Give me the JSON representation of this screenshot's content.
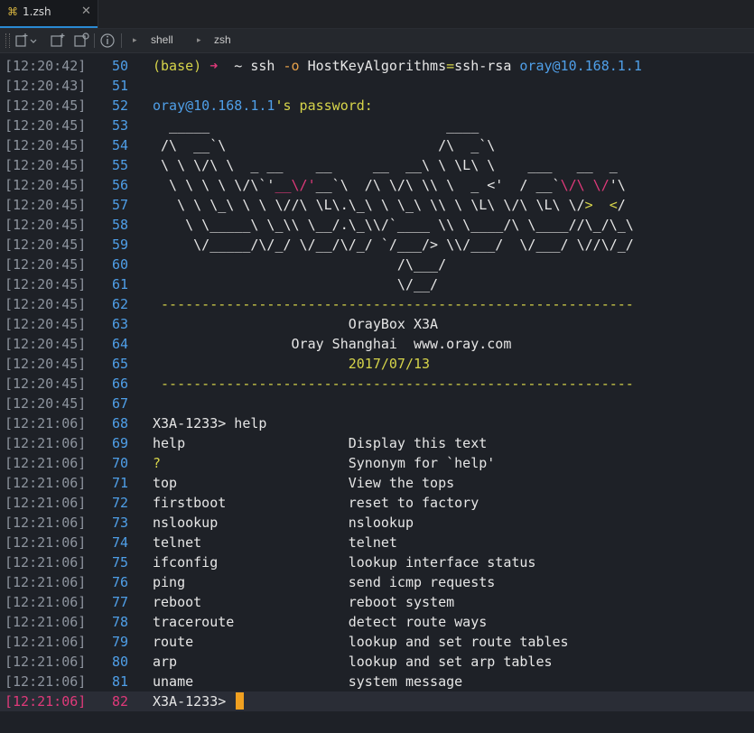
{
  "tab": {
    "cmd_glyph": "⌘",
    "title": "1.zsh",
    "close_glyph": "✕"
  },
  "toolbar": {
    "new_tab_icon": "new-tab-icon",
    "new_window_icon": "new-window-icon",
    "restart_icon": "restart-icon",
    "info_icon": "info-icon",
    "crumbs": [
      "shell",
      "zsh"
    ]
  },
  "colors": {
    "accent": "#2a8ad4",
    "prompt_arrow": "#e0397a",
    "cursor": "#f0a020",
    "line_numbers": "#4f9fe8",
    "timestamps": "#8d949e"
  },
  "lines": [
    {
      "ts": "[12:20:42]",
      "n": "50",
      "segs": [
        [
          "(base) ",
          "yellow"
        ],
        [
          "➜",
          "pink"
        ],
        [
          "  ~ ",
          "white"
        ],
        [
          "ssh ",
          "white"
        ],
        [
          "-o",
          "orange"
        ],
        [
          " HostKeyAlgorithms",
          "white"
        ],
        [
          "=",
          "yellow"
        ],
        [
          "ssh-rsa ",
          "white"
        ],
        [
          "oray@10.168.1.1",
          "blue"
        ]
      ]
    },
    {
      "ts": "[12:20:43]",
      "n": "51",
      "segs": []
    },
    {
      "ts": "[12:20:45]",
      "n": "52",
      "segs": [
        [
          "oray@10.168.1.1",
          "blue"
        ],
        [
          "'s password:",
          "yellow"
        ]
      ]
    },
    {
      "ts": "[12:20:45]",
      "n": "53",
      "segs": [
        [
          "  _____                             ____",
          "white"
        ]
      ]
    },
    {
      "ts": "[12:20:45]",
      "n": "54",
      "segs": [
        [
          " /\\  __`\\                          /\\  _`\\",
          "white"
        ]
      ]
    },
    {
      "ts": "[12:20:45]",
      "n": "55",
      "segs": [
        [
          " \\ \\ \\/\\ \\  _ __    __     __  __\\ \\ \\L\\ \\    ___   __  _",
          "white"
        ]
      ]
    },
    {
      "ts": "[12:20:45]",
      "n": "56",
      "segs": [
        [
          "  \\ \\ \\ \\ \\/\\`'",
          "white"
        ],
        [
          "__\\/'",
          "pink"
        ],
        [
          "__`\\  /\\ \\/\\ \\\\ \\  _ <'  / __`",
          "white"
        ],
        [
          "\\/\\ \\/",
          "pink"
        ],
        [
          "'\\",
          "white"
        ]
      ]
    },
    {
      "ts": "[12:20:45]",
      "n": "57",
      "segs": [
        [
          "   \\ \\ \\_\\ \\ \\ \\//\\ \\L\\.\\_\\ \\ \\_\\ \\\\ \\ \\L\\ \\/\\ \\L\\ \\/",
          "white"
        ],
        [
          ">  <",
          "yellow"
        ],
        [
          "/",
          "white"
        ]
      ]
    },
    {
      "ts": "[12:20:45]",
      "n": "58",
      "segs": [
        [
          "    \\ \\_____\\ \\_\\\\ \\__/.\\_\\\\/`____ \\\\ \\____/\\ \\____//\\_/\\_\\",
          "white"
        ]
      ]
    },
    {
      "ts": "[12:20:45]",
      "n": "59",
      "segs": [
        [
          "     \\/_____/\\/_/ \\/__/\\/_/ `/___/> \\\\/___/  \\/___/ \\//\\/_/",
          "white"
        ]
      ]
    },
    {
      "ts": "[12:20:45]",
      "n": "60",
      "segs": [
        [
          "                              /\\___/",
          "white"
        ]
      ]
    },
    {
      "ts": "[12:20:45]",
      "n": "61",
      "segs": [
        [
          "                              \\/__/",
          "white"
        ]
      ]
    },
    {
      "ts": "[12:20:45]",
      "n": "62",
      "segs": [
        [
          " ----------------------------------------------------------",
          "yellow"
        ]
      ]
    },
    {
      "ts": "[12:20:45]",
      "n": "63",
      "segs": [
        [
          "                        OrayBox X3A",
          "white"
        ]
      ]
    },
    {
      "ts": "[12:20:45]",
      "n": "64",
      "segs": [
        [
          "                 Oray Shanghai  www.oray.com",
          "white"
        ]
      ]
    },
    {
      "ts": "[12:20:45]",
      "n": "65",
      "segs": [
        [
          "                        2017/07/13",
          "yellow"
        ]
      ]
    },
    {
      "ts": "[12:20:45]",
      "n": "66",
      "segs": [
        [
          " ----------------------------------------------------------",
          "yellow"
        ]
      ]
    },
    {
      "ts": "[12:20:45]",
      "n": "67",
      "segs": []
    },
    {
      "ts": "[12:21:06]",
      "n": "68",
      "segs": [
        [
          "X3A-1233> help",
          "white"
        ]
      ]
    },
    {
      "ts": "[12:21:06]",
      "n": "69",
      "segs": [
        [
          "help                    Display this text",
          "white"
        ]
      ]
    },
    {
      "ts": "[12:21:06]",
      "n": "70",
      "segs": [
        [
          "?",
          "yellow"
        ],
        [
          "                       Synonym for `help'",
          "white"
        ]
      ]
    },
    {
      "ts": "[12:21:06]",
      "n": "71",
      "segs": [
        [
          "top                     View the tops",
          "white"
        ]
      ]
    },
    {
      "ts": "[12:21:06]",
      "n": "72",
      "segs": [
        [
          "firstboot               reset to factory",
          "white"
        ]
      ]
    },
    {
      "ts": "[12:21:06]",
      "n": "73",
      "segs": [
        [
          "nslookup                nslookup",
          "white"
        ]
      ]
    },
    {
      "ts": "[12:21:06]",
      "n": "74",
      "segs": [
        [
          "telnet                  telnet",
          "white"
        ]
      ]
    },
    {
      "ts": "[12:21:06]",
      "n": "75",
      "segs": [
        [
          "ifconfig                lookup interface status",
          "white"
        ]
      ]
    },
    {
      "ts": "[12:21:06]",
      "n": "76",
      "segs": [
        [
          "ping                    send icmp requests",
          "white"
        ]
      ]
    },
    {
      "ts": "[12:21:06]",
      "n": "77",
      "segs": [
        [
          "reboot                  reboot system",
          "white"
        ]
      ]
    },
    {
      "ts": "[12:21:06]",
      "n": "78",
      "segs": [
        [
          "traceroute              detect route ways",
          "white"
        ]
      ]
    },
    {
      "ts": "[12:21:06]",
      "n": "79",
      "segs": [
        [
          "route                   lookup and set route tables",
          "white"
        ]
      ]
    },
    {
      "ts": "[12:21:06]",
      "n": "80",
      "segs": [
        [
          "arp                     lookup and set arp tables",
          "white"
        ]
      ]
    },
    {
      "ts": "[12:21:06]",
      "n": "81",
      "segs": [
        [
          "uname                   system message",
          "white"
        ]
      ]
    },
    {
      "ts": "[12:21:06]",
      "n": "82",
      "segs": [
        [
          "X3A-1233> ",
          "white"
        ]
      ],
      "current": true
    }
  ]
}
